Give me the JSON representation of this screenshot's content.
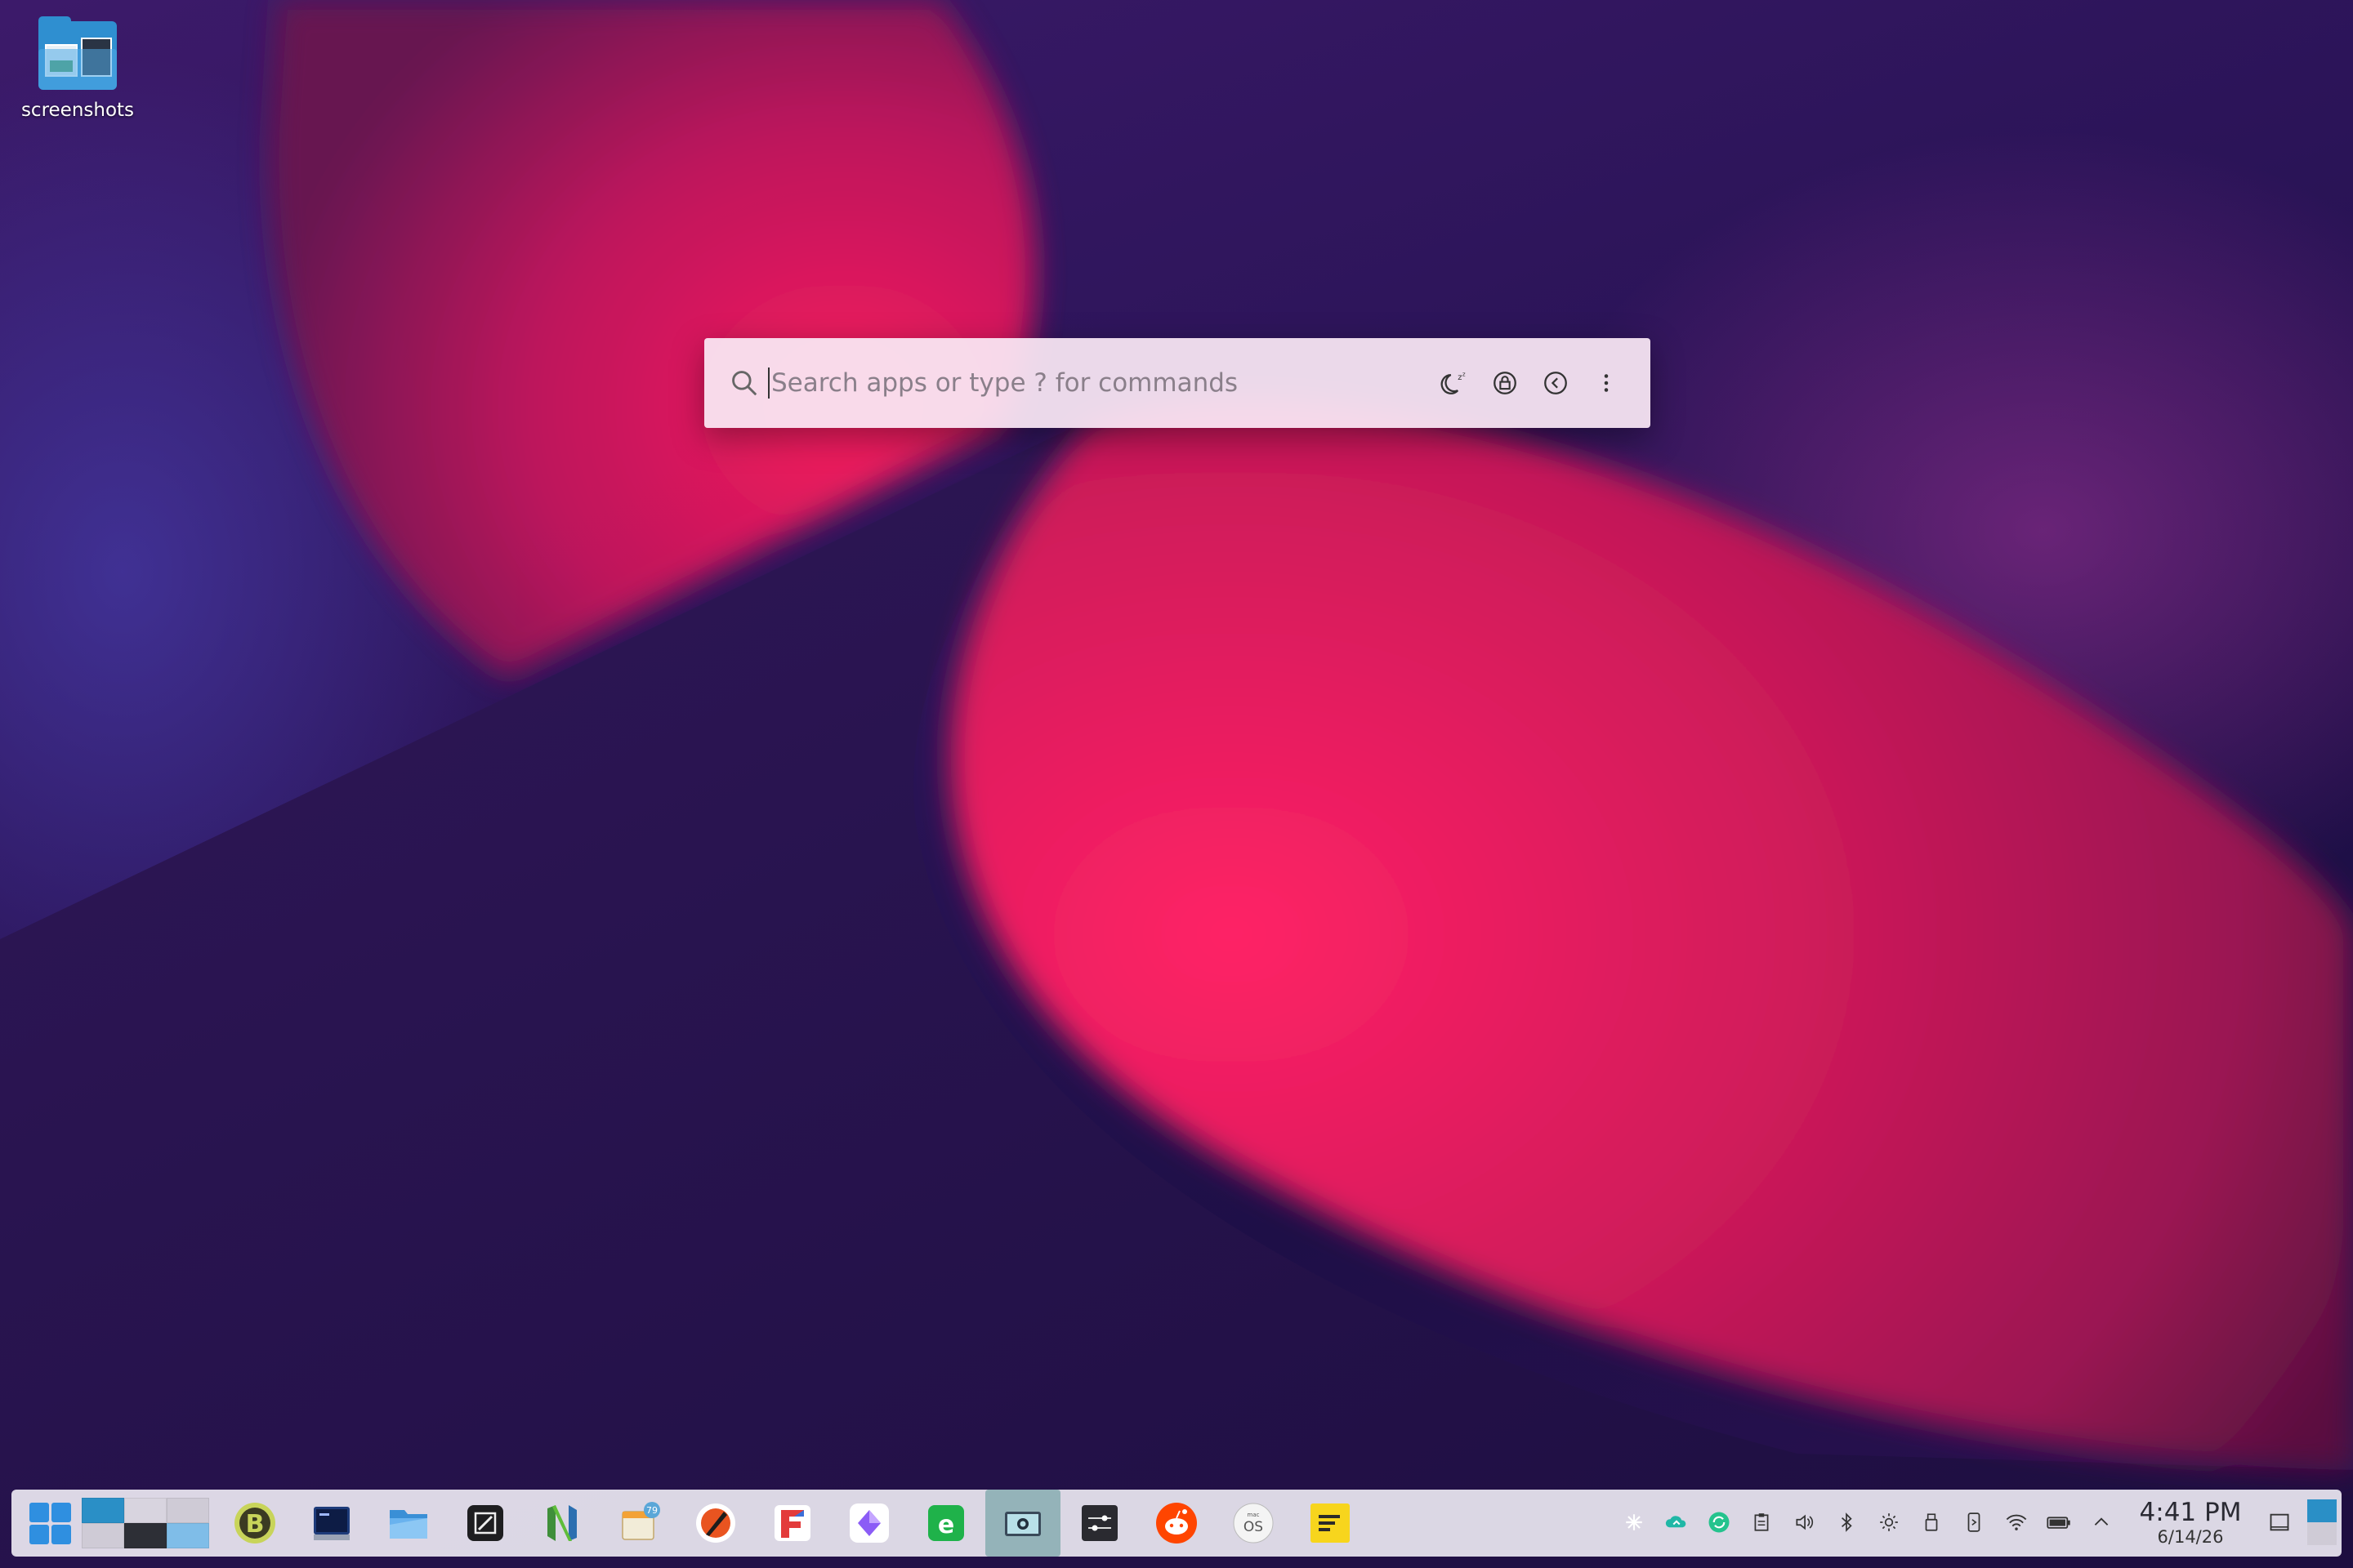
{
  "desktop": {
    "icons": [
      {
        "label": "screenshots",
        "icon": "folder-icon"
      }
    ]
  },
  "launcher": {
    "placeholder": "Search apps or type ? for commands",
    "actions": [
      {
        "name": "sleep",
        "icon": "sleep-moon-icon"
      },
      {
        "name": "lock",
        "icon": "lock-icon"
      },
      {
        "name": "logout",
        "icon": "logout-arrow-icon"
      },
      {
        "name": "more",
        "icon": "kebab-menu-icon"
      }
    ]
  },
  "taskbar": {
    "start_icon": "app-launcher-grid-icon",
    "apps": [
      {
        "name": "bitcoin-wallet",
        "icon": "bitcoin-icon"
      },
      {
        "name": "terminal",
        "icon": "terminal-icon"
      },
      {
        "name": "file-manager",
        "icon": "folder-icon"
      },
      {
        "name": "text-editor",
        "icon": "editor-icon"
      },
      {
        "name": "neovim",
        "icon": "neovim-icon"
      },
      {
        "name": "calendar",
        "icon": "calendar-icon",
        "badge": "79"
      },
      {
        "name": "vpn",
        "icon": "slash-circle-icon"
      },
      {
        "name": "fontforge",
        "icon": "f-logo-icon"
      },
      {
        "name": "obsidian",
        "icon": "diamond-icon"
      },
      {
        "name": "browser",
        "icon": "e-browser-icon"
      },
      {
        "name": "screenshot-tool",
        "icon": "camera-icon",
        "active": true
      },
      {
        "name": "settings",
        "icon": "sliders-icon"
      },
      {
        "name": "reddit",
        "icon": "reddit-icon"
      },
      {
        "name": "macos-vm",
        "icon": "macos-icon"
      },
      {
        "name": "notes",
        "icon": "notes-icon"
      }
    ],
    "tray": [
      "sparkle-icon",
      "cloud-sync-icon",
      "refresh-icon",
      "clipboard-icon",
      "volume-icon",
      "bluetooth-icon",
      "brightness-icon",
      "usb-icon",
      "kdeconnect-icon",
      "wifi-icon",
      "battery-icon",
      "chevron-up-icon"
    ],
    "clock": {
      "time": "4:41 PM",
      "date": "6/14/26"
    },
    "colors": {
      "accent": "#2f8fe0"
    }
  }
}
